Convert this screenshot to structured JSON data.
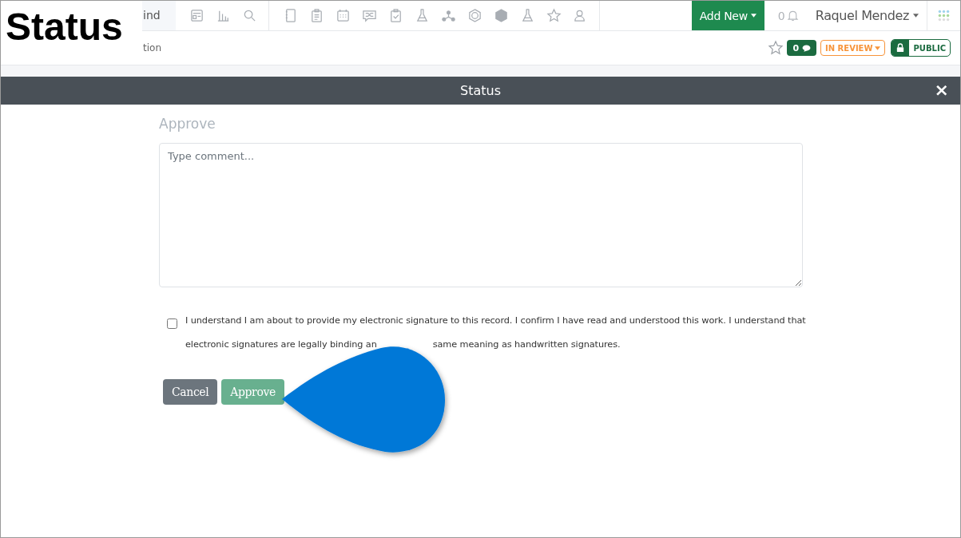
{
  "title_label": "Status",
  "header": {
    "search_fragment": "ind",
    "add_new": "Add New",
    "notifications_count": "0",
    "user_name": "Raquel Mendez"
  },
  "subheader": {
    "breadcrumb_fragment": "tion",
    "starred": false,
    "comment_count": "0",
    "status": "IN REVIEW",
    "visibility": "PUBLIC"
  },
  "modal": {
    "title": "Status",
    "close": "×",
    "heading": "Approve",
    "comment": {
      "placeholder": "Type comment..."
    },
    "agreement": {
      "checked": false,
      "line_1": "I understand I am about to provide my electronic signature to this record. I confirm I have read and understood this work. I understand that",
      "line_2_parts": [
        "electronic signatures are legally binding an",
        "same meaning as handwritten signatures."
      ]
    },
    "buttons": [
      {
        "label": "Cancel",
        "kind": "cancel",
        "disabled": false
      },
      {
        "label": "Approve",
        "kind": "confirm",
        "disabled": true
      }
    ]
  }
}
